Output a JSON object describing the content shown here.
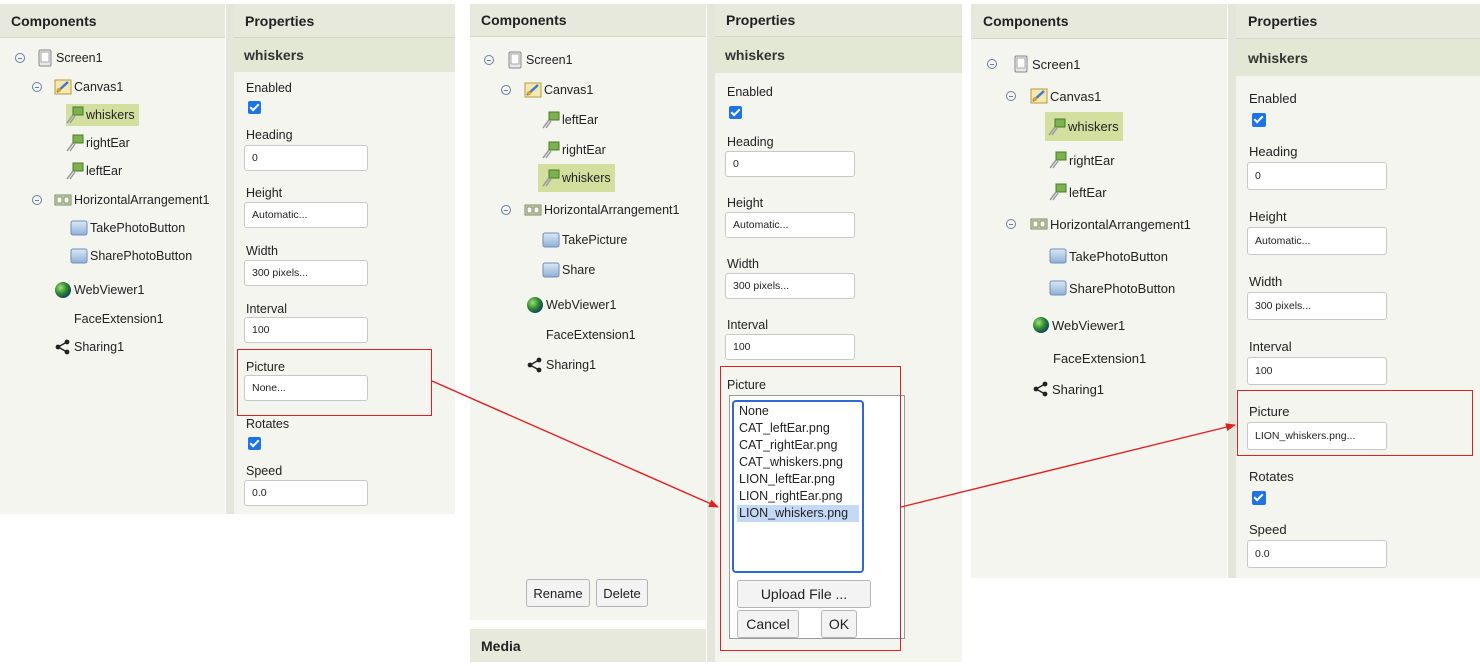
{
  "headers": {
    "components": "Components",
    "properties": "Properties",
    "media": "Media"
  },
  "selected_component": "whiskers",
  "labels": {
    "enabled": "Enabled",
    "heading": "Heading",
    "height": "Height",
    "width": "Width",
    "interval": "Interval",
    "picture": "Picture",
    "rotates": "Rotates",
    "speed": "Speed"
  },
  "values": {
    "heading": "0",
    "height": "Automatic...",
    "width": "300 pixels...",
    "interval": "100",
    "speed": "0.0",
    "enabled": true,
    "rotates": true
  },
  "panel1": {
    "tree": {
      "screen": "Screen1",
      "canvas": "Canvas1",
      "sprites": [
        "whiskers",
        "rightEar",
        "leftEar"
      ],
      "arrangement": "HorizontalArrangement1",
      "buttons": [
        "TakePhotoButton",
        "SharePhotoButton"
      ],
      "webviewer": "WebViewer1",
      "face": "FaceExtension1",
      "sharing": "Sharing1"
    },
    "picture_value": "None..."
  },
  "panel2": {
    "tree": {
      "screen": "Screen1",
      "canvas": "Canvas1",
      "sprites": [
        "leftEar",
        "rightEar",
        "whiskers"
      ],
      "arrangement": "HorizontalArrangement1",
      "buttons": [
        "TakePicture",
        "Share"
      ],
      "webviewer": "WebViewer1",
      "face": "FaceExtension1",
      "sharing": "Sharing1"
    },
    "rename": "Rename",
    "delete": "Delete",
    "picker": {
      "options": [
        "None",
        "CAT_leftEar.png",
        "CAT_rightEar.png",
        "CAT_whiskers.png",
        "LION_leftEar.png",
        "LION_rightEar.png",
        "LION_whiskers.png"
      ],
      "selected_index": 6,
      "upload": "Upload File ...",
      "cancel": "Cancel",
      "ok": "OK"
    }
  },
  "panel3": {
    "tree": {
      "screen": "Screen1",
      "canvas": "Canvas1",
      "sprites": [
        "whiskers",
        "rightEar",
        "leftEar"
      ],
      "arrangement": "HorizontalArrangement1",
      "buttons": [
        "TakePhotoButton",
        "SharePhotoButton"
      ],
      "webviewer": "WebViewer1",
      "face": "FaceExtension1",
      "sharing": "Sharing1"
    },
    "picture_value": "LION_whiskers.png..."
  },
  "colors": {
    "selection": "#d3df9f",
    "highlight_box": "#e02020",
    "arrow": "#e02020",
    "checkbox": "#1f73e8",
    "listbox_border": "#2f68d4"
  }
}
